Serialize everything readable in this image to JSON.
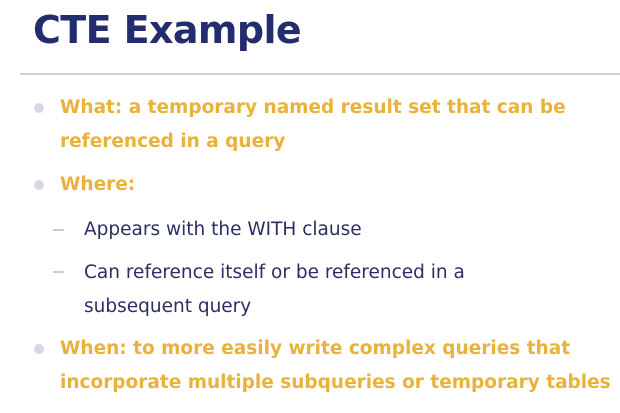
{
  "slide": {
    "title": "CTE Example",
    "bullets": [
      {
        "lines": [
          "What: a temporary named result set that can be",
          "referenced in a query"
        ]
      },
      {
        "lines": [
          "Where:"
        ],
        "subitems": [
          {
            "lines": [
              "Appears with the WITH clause"
            ]
          },
          {
            "lines": [
              "Can reference itself or be referenced in a",
              "subsequent query"
            ]
          }
        ]
      },
      {
        "lines": [
          "When: to more easily write complex queries that",
          "incorporate multiple subqueries or temporary tables"
        ]
      }
    ]
  },
  "colors": {
    "title": "#232d6e",
    "highlight": "#e9b23a",
    "body_text": "#2a2f63",
    "bullet": "#d4d8e4",
    "divider": "#cfd0d6"
  }
}
